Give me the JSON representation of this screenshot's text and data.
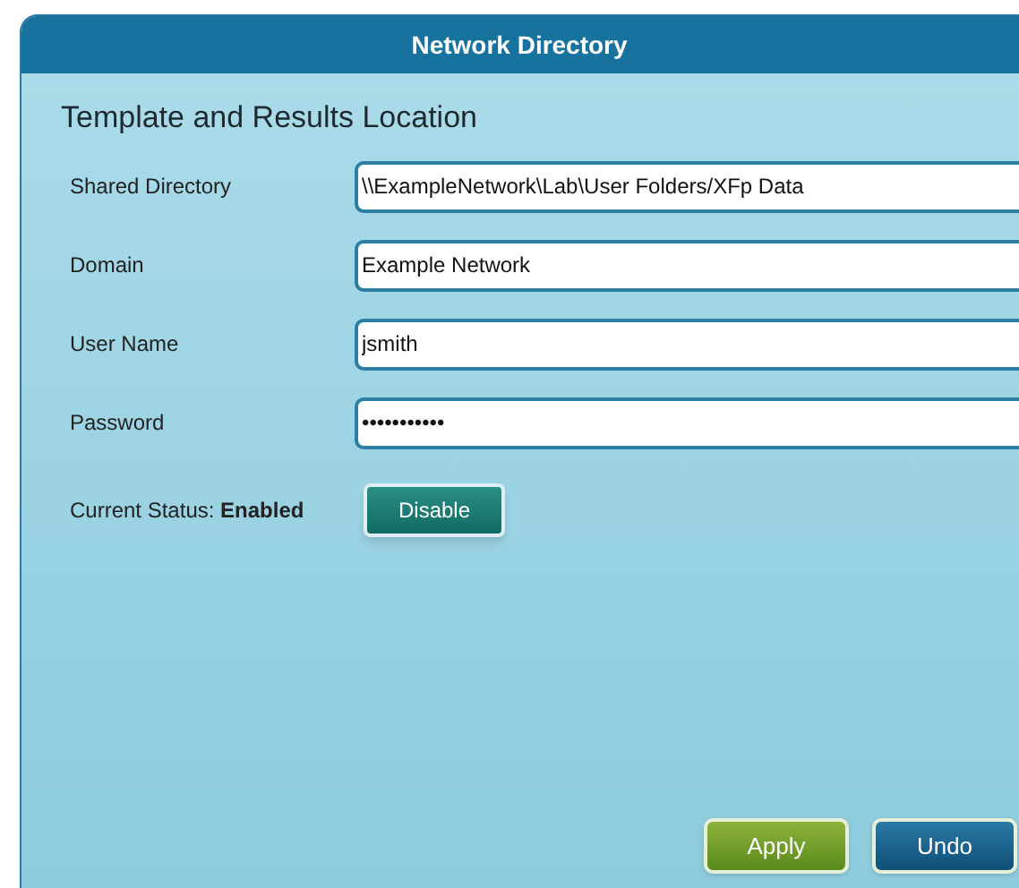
{
  "window": {
    "title": "Network Directory"
  },
  "section_title": "Template and Results Location",
  "fields": [
    {
      "label": "Shared Directory",
      "value": "\\\\ExampleNetwork\\Lab\\User Folders/XFp Data"
    },
    {
      "label": "Domain",
      "value": "Example Network"
    },
    {
      "label": "User Name",
      "value": "jsmith"
    },
    {
      "label": "Password",
      "value": "•••••••••••"
    }
  ],
  "status": {
    "text": "Current Status: **Enabled**",
    "button": "Disable"
  },
  "buttons": [
    {
      "label": "Apply",
      "kind": "primary"
    },
    {
      "label": "Undo",
      "kind": "secondary"
    }
  ]
}
